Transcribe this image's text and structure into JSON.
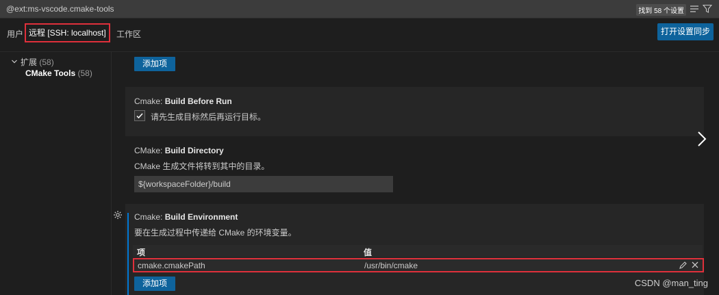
{
  "search": {
    "query": "@ext:ms-vscode.cmake-tools",
    "count": "找到 58 个设置"
  },
  "tabs": {
    "user": "用户",
    "remote": "远程 [SSH: localhost]",
    "workspace": "工作区"
  },
  "sync_button": "打开设置同步",
  "toc": {
    "extensions_label": "扩展",
    "extensions_count": "(58)",
    "cmake_label": "CMake Tools",
    "cmake_count": "(58)"
  },
  "top_add_button": "添加项",
  "build_before_run": {
    "prefix": "Cmake: ",
    "name": "Build Before Run",
    "description": "请先生成目标然后再运行目标。",
    "checked": true
  },
  "build_directory": {
    "prefix": "CMake: ",
    "name": "Build Directory",
    "description": "CMake 生成文件将转到其中的目录。",
    "value": "${workspaceFolder}/build"
  },
  "build_environment": {
    "prefix": "Cmake: ",
    "name": "Build Environment",
    "description": "要在生成过程中传递给 CMake 的环境变量。",
    "header_key": "项",
    "header_value": "值",
    "rows": [
      {
        "key": "cmake.cmakePath",
        "value": "/usr/bin/cmake"
      }
    ],
    "add_button": "添加项"
  },
  "watermark": "CSDN @man_ting"
}
